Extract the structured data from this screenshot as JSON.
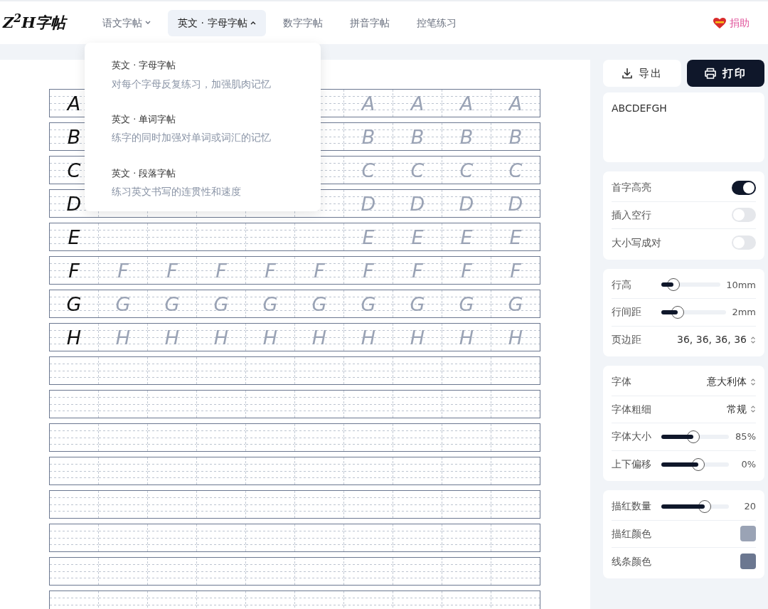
{
  "logo": "Z$^{2}$H字帖",
  "nav": [
    {
      "label": "语文字帖",
      "dropdown": true,
      "expanded": false,
      "selected": false
    },
    {
      "label": "英文 · 字母字帖",
      "dropdown": true,
      "expanded": true,
      "selected": true
    },
    {
      "label": "数字字帖",
      "dropdown": false,
      "selected": false
    },
    {
      "label": "拼音字帖",
      "dropdown": false,
      "selected": false
    },
    {
      "label": "控笔练习",
      "dropdown": false,
      "selected": false
    }
  ],
  "donate": {
    "label": "捐助"
  },
  "menu": [
    {
      "title": "英文 · 字母字帖",
      "description": "对每个字母反复练习，加强肌肉记忆"
    },
    {
      "title": "英文 · 单词字帖",
      "description": "练字的同时加强对单词或词汇的记忆"
    },
    {
      "title": "英文 · 段落字帖",
      "description": "练习英文书写的连贯性和速度"
    }
  ],
  "sheet": {
    "rows": [
      {
        "cells": [
          "A",
          null,
          null,
          null,
          null,
          null,
          "A",
          "A",
          "A",
          "A"
        ]
      },
      {
        "cells": [
          "B",
          null,
          null,
          null,
          null,
          null,
          "B",
          "B",
          "B",
          "B"
        ]
      },
      {
        "cells": [
          "C",
          null,
          null,
          null,
          null,
          null,
          "C",
          "C",
          "C",
          "C"
        ]
      },
      {
        "cells": [
          "D",
          null,
          null,
          null,
          null,
          null,
          "D",
          "D",
          "D",
          "D"
        ]
      },
      {
        "cells": [
          "E",
          null,
          null,
          null,
          null,
          null,
          "E",
          "E",
          "E",
          "E"
        ]
      },
      {
        "cells": [
          "F",
          "F",
          "F",
          "F",
          "F",
          "F",
          "F",
          "F",
          "F",
          "F"
        ]
      },
      {
        "cells": [
          "G",
          "G",
          "G",
          "G",
          "G",
          "G",
          "G",
          "G",
          "G",
          "G"
        ]
      },
      {
        "cells": [
          "H",
          "H",
          "H",
          "H",
          "H",
          "H",
          "H",
          "H",
          "H",
          "H"
        ]
      },
      {
        "cells": [
          null,
          null,
          null,
          null,
          null,
          null,
          null,
          null,
          null,
          null
        ]
      },
      {
        "cells": [
          null,
          null,
          null,
          null,
          null,
          null,
          null,
          null,
          null,
          null
        ]
      },
      {
        "cells": [
          null,
          null,
          null,
          null,
          null,
          null,
          null,
          null,
          null,
          null
        ]
      },
      {
        "cells": [
          null,
          null,
          null,
          null,
          null,
          null,
          null,
          null,
          null,
          null
        ]
      },
      {
        "cells": [
          null,
          null,
          null,
          null,
          null,
          null,
          null,
          null,
          null,
          null
        ]
      },
      {
        "cells": [
          null,
          null,
          null,
          null,
          null,
          null,
          null,
          null,
          null,
          null
        ]
      },
      {
        "cells": [
          null,
          null,
          null,
          null,
          null,
          null,
          null,
          null,
          null,
          null
        ]
      },
      {
        "cells": [
          null,
          null,
          null,
          null,
          null,
          null,
          null,
          null,
          null,
          null
        ]
      }
    ]
  },
  "actions": [
    {
      "kind": "export",
      "label": "导出"
    },
    {
      "kind": "print",
      "label": "打印"
    }
  ],
  "text_input": {
    "value": "ABCDEFGH"
  },
  "settings": [
    {
      "rows": [
        {
          "kind": "toggle",
          "label": "首字高亮",
          "on": true
        },
        {
          "kind": "toggle",
          "label": "插入空行",
          "on": false
        },
        {
          "kind": "toggle",
          "label": "大小写成对",
          "on": false
        }
      ]
    },
    {
      "rows": [
        {
          "kind": "slider",
          "label": "行高",
          "level": 0.2,
          "reading": "10mm"
        },
        {
          "kind": "slider",
          "label": "行间距",
          "level": 0.25,
          "reading": "2mm"
        },
        {
          "kind": "select",
          "label": "页边距",
          "value": "36, 36, 36, 36"
        }
      ]
    },
    {
      "rows": [
        {
          "kind": "select",
          "label": "字体",
          "value": "意大利体"
        },
        {
          "kind": "select",
          "label": "字体粗细",
          "value": "常规"
        },
        {
          "kind": "slider",
          "label": "字体大小",
          "level": 0.47,
          "reading": "85%"
        },
        {
          "kind": "slider",
          "label": "上下偏移",
          "level": 0.55,
          "reading": "0%"
        }
      ]
    },
    {
      "rows": [
        {
          "kind": "slider",
          "label": "描红数量",
          "level": 0.64,
          "reading": "20"
        },
        {
          "kind": "color",
          "label": "描红颜色",
          "color": "#9aa3b5"
        },
        {
          "kind": "color",
          "label": "线条颜色",
          "color": "#6b7790"
        }
      ]
    }
  ]
}
